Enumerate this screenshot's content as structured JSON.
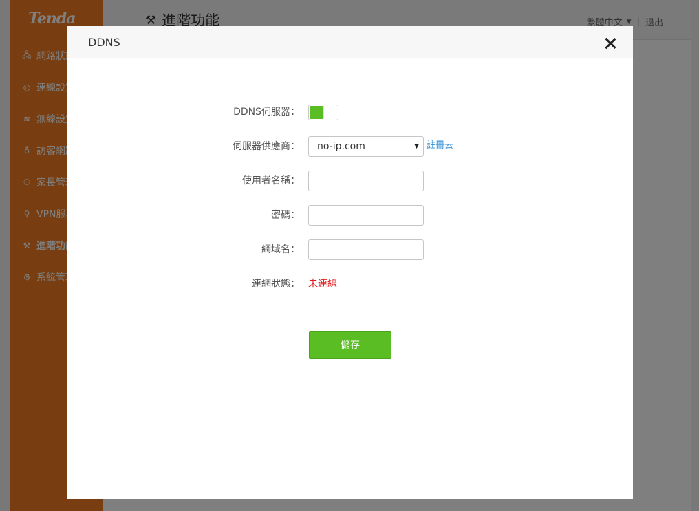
{
  "app": {
    "logo": "Tenda",
    "page_title": "進階功能",
    "language": "繁體中文",
    "logout": "退出"
  },
  "sidebar": {
    "items": [
      {
        "label": "網路狀態",
        "icon": "network-status-icon",
        "glyph": "🖧"
      },
      {
        "label": "連線設定",
        "icon": "globe-icon",
        "glyph": "◎"
      },
      {
        "label": "無線設定",
        "icon": "wifi-icon",
        "glyph": "≋"
      },
      {
        "label": "訪客網路",
        "icon": "guest-network-icon",
        "glyph": "♁"
      },
      {
        "label": "家長管理",
        "icon": "parental-control-icon",
        "glyph": "⚇"
      },
      {
        "label": "VPN服務",
        "icon": "vpn-icon",
        "glyph": "⚲"
      },
      {
        "label": "進階功能",
        "icon": "wrench-icon",
        "glyph": "⚒",
        "active": true
      },
      {
        "label": "系統管理",
        "icon": "settings-icon",
        "glyph": "⚙"
      }
    ]
  },
  "modal": {
    "title": "DDNS",
    "fields": {
      "ddns_server_label": "DDNS伺服器：",
      "ddns_server_enabled": true,
      "provider_label": "伺服器供應商：",
      "provider_value": "no-ip.com",
      "register_link": "註冊去",
      "username_label": "使用者名稱：",
      "username_value": "",
      "password_label": "密碼：",
      "password_value": "",
      "domain_label": "網域名：",
      "domain_value": "",
      "status_label": "連網狀態：",
      "status_value": "未連線"
    },
    "save_label": "儲存"
  },
  "colors": {
    "brand_orange": "#f07d22",
    "accent_green": "#5bbd24",
    "status_red": "#e02020",
    "link_blue": "#2e8fd6"
  }
}
